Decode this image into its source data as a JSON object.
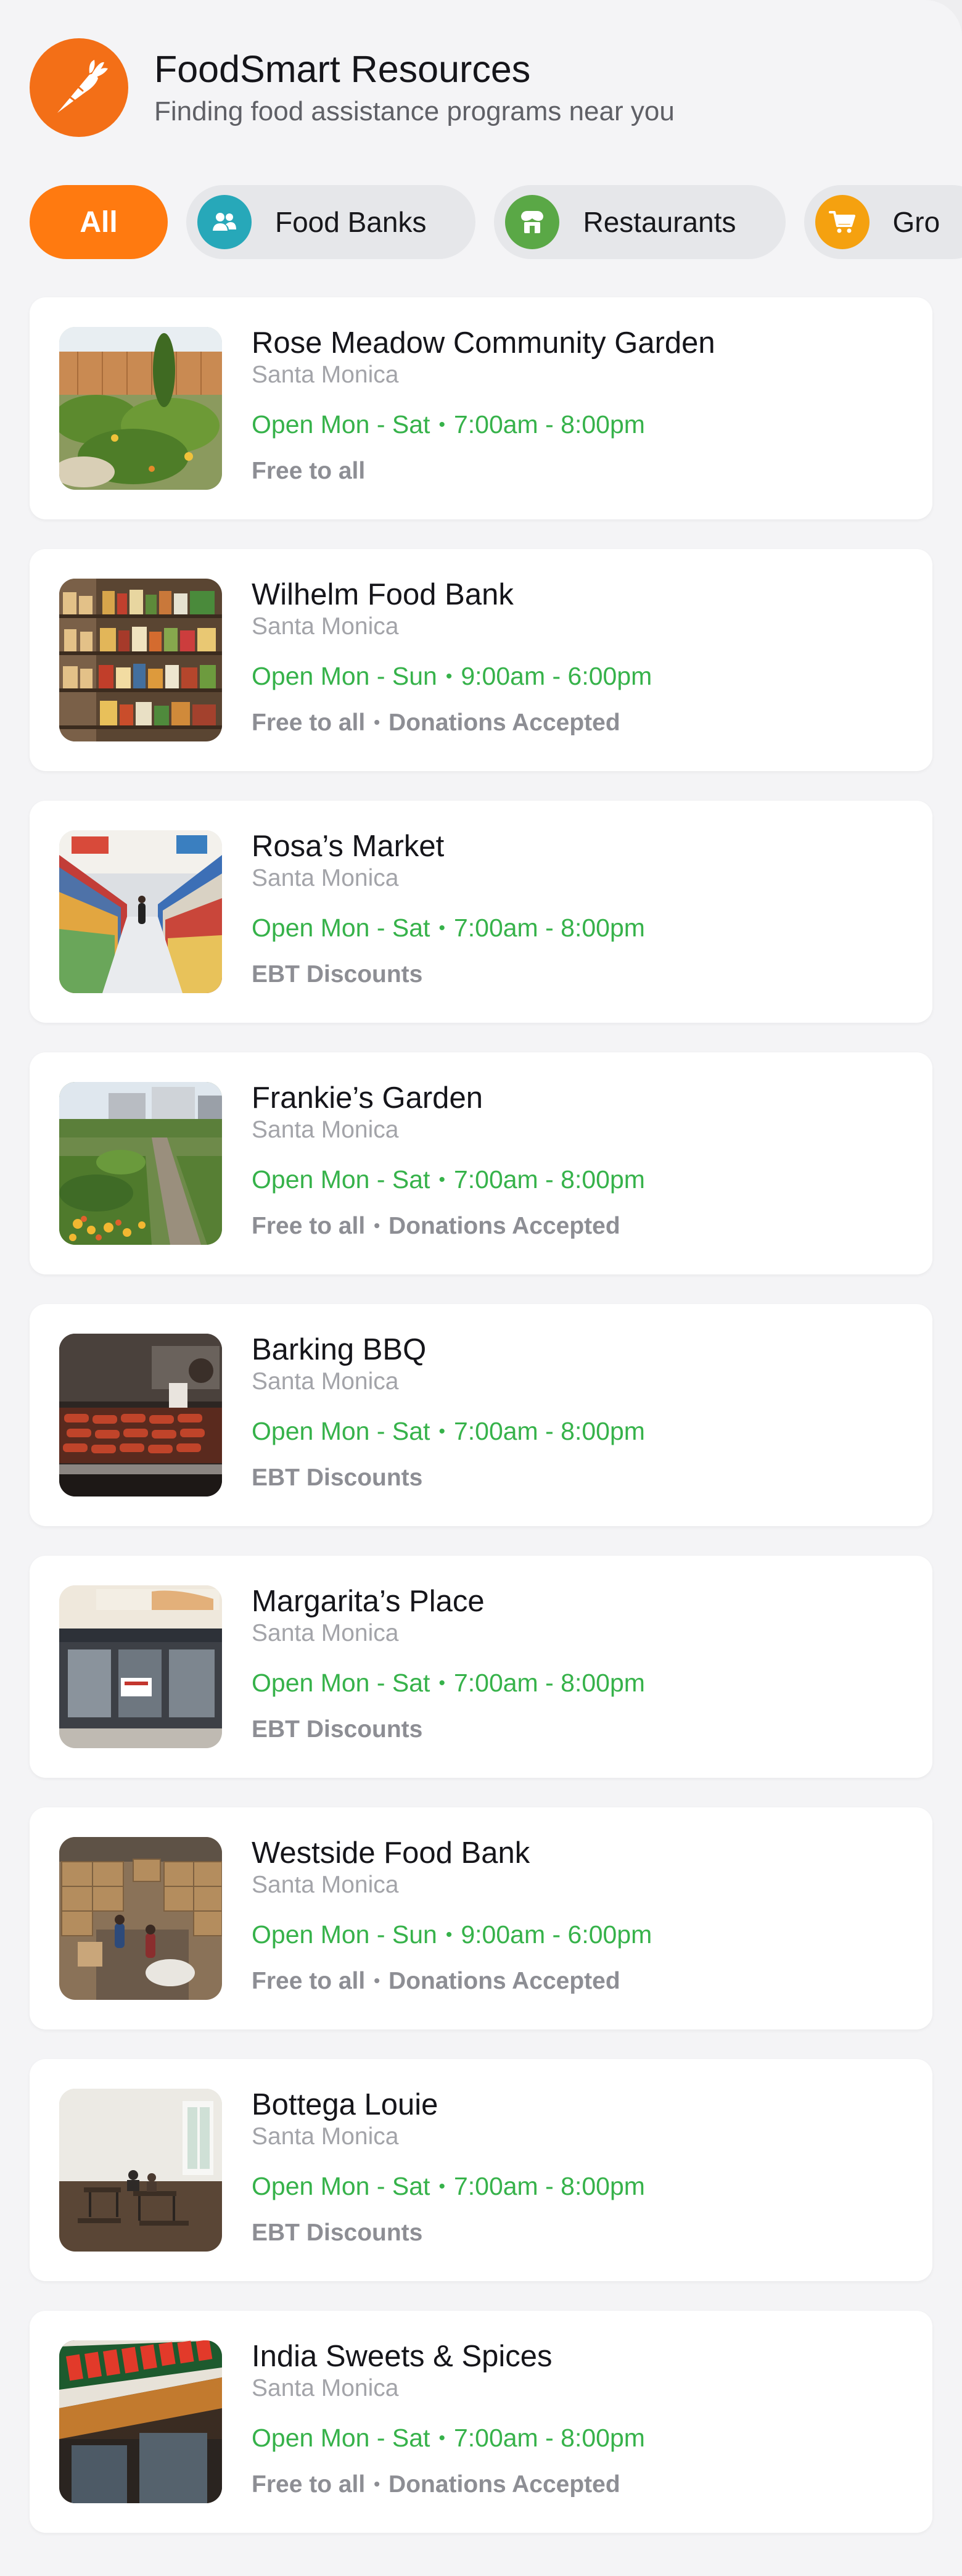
{
  "header": {
    "title": "FoodSmart Resources",
    "subtitle": "Finding food assistance programs near you",
    "logo_icon": "carrot-icon",
    "brand_color": "#f36f17"
  },
  "filters": [
    {
      "label": "All",
      "active": true,
      "icon": "",
      "icon_color": "#ff7a10"
    },
    {
      "label": "Food Banks",
      "active": false,
      "icon": "people-icon",
      "icon_color": "#27a8b9"
    },
    {
      "label": "Restaurants",
      "active": false,
      "icon": "storefront-icon",
      "icon_color": "#5aa846"
    },
    {
      "label": "Gro",
      "active": false,
      "icon": "shopping-cart-icon",
      "icon_color": "#f5a10f"
    }
  ],
  "hours_color": "#36b24a",
  "locations": [
    {
      "name": "Rose Meadow Community Garden",
      "city": "Santa Monica",
      "days": "Open Mon - Sat",
      "hours": "7:00am - 8:00pm",
      "tags": [
        "Free to all"
      ],
      "image": "garden-photo"
    },
    {
      "name": "Wilhelm Food Bank",
      "city": "Santa Monica",
      "days": "Open Mon - Sun",
      "hours": "9:00am - 6:00pm",
      "tags": [
        "Free to all",
        "Donations Accepted"
      ],
      "image": "pantry-shelves-photo"
    },
    {
      "name": "Rosa’s Market",
      "city": "Santa Monica",
      "days": "Open Mon - Sat",
      "hours": "7:00am - 8:00pm",
      "tags": [
        "EBT Discounts"
      ],
      "image": "market-aisle-photo"
    },
    {
      "name": "Frankie’s Garden",
      "city": "Santa Monica",
      "days": "Open Mon - Sat",
      "hours": "7:00am - 8:00pm",
      "tags": [
        "Free to all",
        "Donations Accepted"
      ],
      "image": "urban-garden-photo"
    },
    {
      "name": "Barking BBQ",
      "city": "Santa Monica",
      "days": "Open Mon - Sat",
      "hours": "7:00am - 8:00pm",
      "tags": [
        "EBT Discounts"
      ],
      "image": "bbq-grill-photo"
    },
    {
      "name": "Margarita’s Place",
      "city": "Santa Monica",
      "days": "Open Mon - Sat",
      "hours": "7:00am - 8:00pm",
      "tags": [
        "EBT Discounts"
      ],
      "image": "storefront-photo"
    },
    {
      "name": "Westside Food Bank",
      "city": "Santa Monica",
      "days": "Open Mon - Sun",
      "hours": "9:00am - 6:00pm",
      "tags": [
        "Free to all",
        "Donations Accepted"
      ],
      "image": "warehouse-photo"
    },
    {
      "name": "Bottega Louie",
      "city": "Santa Monica",
      "days": "Open Mon - Sat",
      "hours": "7:00am - 8:00pm",
      "tags": [
        "EBT Discounts"
      ],
      "image": "dining-room-photo"
    },
    {
      "name": "India Sweets & Spices",
      "city": "Santa Monica",
      "days": "Open Mon - Sat",
      "hours": "7:00am - 8:00pm",
      "tags": [
        "Free to all",
        "Donations Accepted"
      ],
      "image": "shop-sign-photo"
    }
  ]
}
